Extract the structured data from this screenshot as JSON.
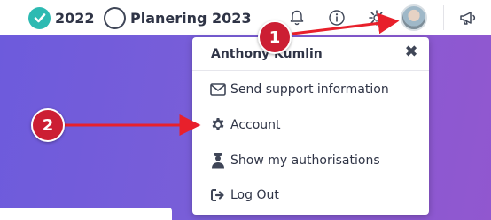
{
  "topbar": {
    "year_checked": "2022",
    "year_unchecked": "Planering 2023",
    "icons": [
      "bell-icon",
      "info-icon",
      "gear-icon",
      "megaphone-icon"
    ]
  },
  "menu": {
    "user_name": "Anthony Kumlin",
    "close_symbol": "✖",
    "items": [
      {
        "label": "Send support information",
        "icon": "envelope-icon"
      },
      {
        "label": "Account",
        "icon": "gear-icon"
      },
      {
        "label": "Show my authorisations",
        "icon": "user-badge-icon"
      },
      {
        "label": "Log Out",
        "icon": "logout-icon"
      }
    ]
  },
  "annotations": {
    "badge_1": "1",
    "badge_2": "2"
  },
  "colors": {
    "accent_teal": "#2dbab2",
    "hero_purple": "#7a5ed8",
    "annotation_red": "#cc1e33",
    "text_dark": "#2f3446"
  }
}
